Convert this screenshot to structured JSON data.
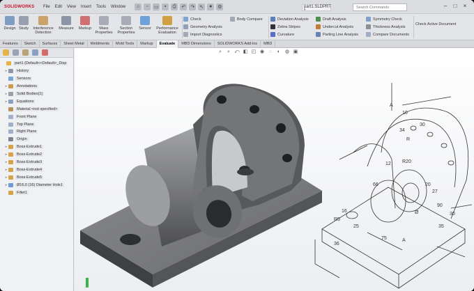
{
  "app": {
    "logo": "SOLIDWORKS",
    "document_title": "part1.SLDPRT *",
    "search_placeholder": "Search Commands"
  },
  "menu": [
    "File",
    "Edit",
    "View",
    "Insert",
    "Tools",
    "Window"
  ],
  "ribbon": {
    "large_buttons": [
      {
        "label": "Design",
        "icon": "design-icon"
      },
      {
        "label": "Study",
        "icon": "study-icon"
      },
      {
        "label": "Interference Detection",
        "icon": "interference-icon"
      },
      {
        "label": "Measure",
        "icon": "measure-icon"
      },
      {
        "label": "Markup",
        "icon": "markup-icon"
      },
      {
        "label": "Mass Properties",
        "icon": "mass-icon"
      },
      {
        "label": "Section Properties",
        "icon": "section-icon"
      },
      {
        "label": "Sensor",
        "icon": "sensor-icon"
      },
      {
        "label": "Performance Evaluation",
        "icon": "performance-icon"
      }
    ],
    "col1": [
      "Check",
      "Geometry Analysis",
      "Import Diagnostics"
    ],
    "col2": [
      "Body Compare"
    ],
    "col3": [
      "Deviation Analysis",
      "Zebra Stripes",
      "Curvature"
    ],
    "col4": [
      "Draft Analysis",
      "Undercut Analysis",
      "Parting Line Analysis"
    ],
    "col5": [
      "Symmetry Check",
      "Thickness Analysis",
      "Compare Documents"
    ],
    "col6": [
      "Check Active Document"
    ]
  },
  "tabs": [
    {
      "label": "Features",
      "active": false
    },
    {
      "label": "Sketch",
      "active": false
    },
    {
      "label": "Surfaces",
      "active": false
    },
    {
      "label": "Sheet Metal",
      "active": false
    },
    {
      "label": "Weldments",
      "active": false
    },
    {
      "label": "Mold Tools",
      "active": false
    },
    {
      "label": "Markup",
      "active": false
    },
    {
      "label": "Evaluate",
      "active": true
    },
    {
      "label": "MBD Dimensions",
      "active": false
    },
    {
      "label": "SOLIDWORKS Add-Ins",
      "active": false
    },
    {
      "label": "MBD",
      "active": false
    }
  ],
  "tree": [
    {
      "label": "part1 (Default<<Default>_Disp",
      "expander": "",
      "indent": 0,
      "color": "#e7b347"
    },
    {
      "label": "History",
      "expander": "▸",
      "indent": 1,
      "color": "#8c96a8"
    },
    {
      "label": "Sensors",
      "expander": "",
      "indent": 1,
      "color": "#7aa6d6"
    },
    {
      "label": "Annotations",
      "expander": "▸",
      "indent": 1,
      "color": "#c99b4e"
    },
    {
      "label": "Solid Bodies(1)",
      "expander": "▸",
      "indent": 1,
      "color": "#9aa0aa"
    },
    {
      "label": "Equations",
      "expander": "▸",
      "indent": 1,
      "color": "#8aa0c4"
    },
    {
      "label": "Material <not specified>",
      "expander": "",
      "indent": 1,
      "color": "#b5945c"
    },
    {
      "label": "Front Plane",
      "expander": "",
      "indent": 1,
      "color": "#9fb0c8"
    },
    {
      "label": "Top Plane",
      "expander": "",
      "indent": 1,
      "color": "#9fb0c8"
    },
    {
      "label": "Right Plane",
      "expander": "",
      "indent": 1,
      "color": "#9fb0c8"
    },
    {
      "label": "Origin",
      "expander": "",
      "indent": 1,
      "color": "#7a8494"
    },
    {
      "label": "Boss-Extrude1",
      "expander": "▸",
      "indent": 1,
      "color": "#d8a24a"
    },
    {
      "label": "Boss-Extrude2",
      "expander": "▸",
      "indent": 1,
      "color": "#d8a24a"
    },
    {
      "label": "Boss-Extrude3",
      "expander": "▸",
      "indent": 1,
      "color": "#d8a24a"
    },
    {
      "label": "Boss-Extrude4",
      "expander": "▸",
      "indent": 1,
      "color": "#d8a24a"
    },
    {
      "label": "Boss-Extrude5",
      "expander": "▸",
      "indent": 1,
      "color": "#d8a24a"
    },
    {
      "label": "Ø16.0 (16) Diameter Hole1",
      "expander": "▸",
      "indent": 1,
      "color": "#6e9bd1"
    },
    {
      "label": "Fillet1",
      "expander": "",
      "indent": 1,
      "color": "#d8a24a"
    }
  ],
  "drawing_dims": [
    "34",
    "30",
    "10",
    "12",
    "R",
    "R20",
    "66",
    "20",
    "27",
    "90",
    "16",
    "R5",
    "25",
    "35",
    "36",
    "75",
    "A",
    "A",
    "30",
    "Ø"
  ],
  "colors": {
    "accent_red": "#c8102e",
    "model_fill": "#6d6e70"
  }
}
